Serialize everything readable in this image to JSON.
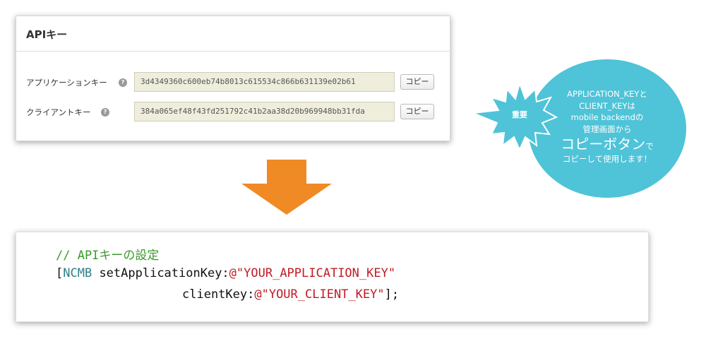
{
  "panel": {
    "title": "APIキー",
    "help_glyph": "?",
    "rows": [
      {
        "label": "アプリケーションキー",
        "value": "3d4349360c600eb74b8013c615534c866b631139e02b61",
        "copy_label": "コピー"
      },
      {
        "label": "クライアントキー",
        "value": "384a065ef48f43fd251792c41b2aa38d20b969948bb31fda",
        "copy_label": "コピー"
      }
    ]
  },
  "callout": {
    "badge": "重要",
    "line1": "APPLICATION_KEYと",
    "line2": "CLIENT_KEYは",
    "line3": "mobile backendの",
    "line4": "管理画面から",
    "emphasis": "コピーボタン",
    "emphasis_suffix": "で",
    "line6": "コピーして使用します！"
  },
  "code": {
    "comment": "// APIキーの設定",
    "open_bracket": "[",
    "class_name": "NCMB",
    "method1": " setApplicationKey:",
    "string1": "@\"YOUR_APPLICATION_KEY\"",
    "method2": "clientKey:",
    "string2": "@\"YOUR_CLIENT_KEY\"",
    "close": "];"
  },
  "colors": {
    "arrow": "#f08a24",
    "bubble": "#4fc3d8",
    "starburst": "#4fc3d8",
    "comment": "#3a9a2c",
    "string": "#c11a24",
    "class": "#2f7f88"
  }
}
